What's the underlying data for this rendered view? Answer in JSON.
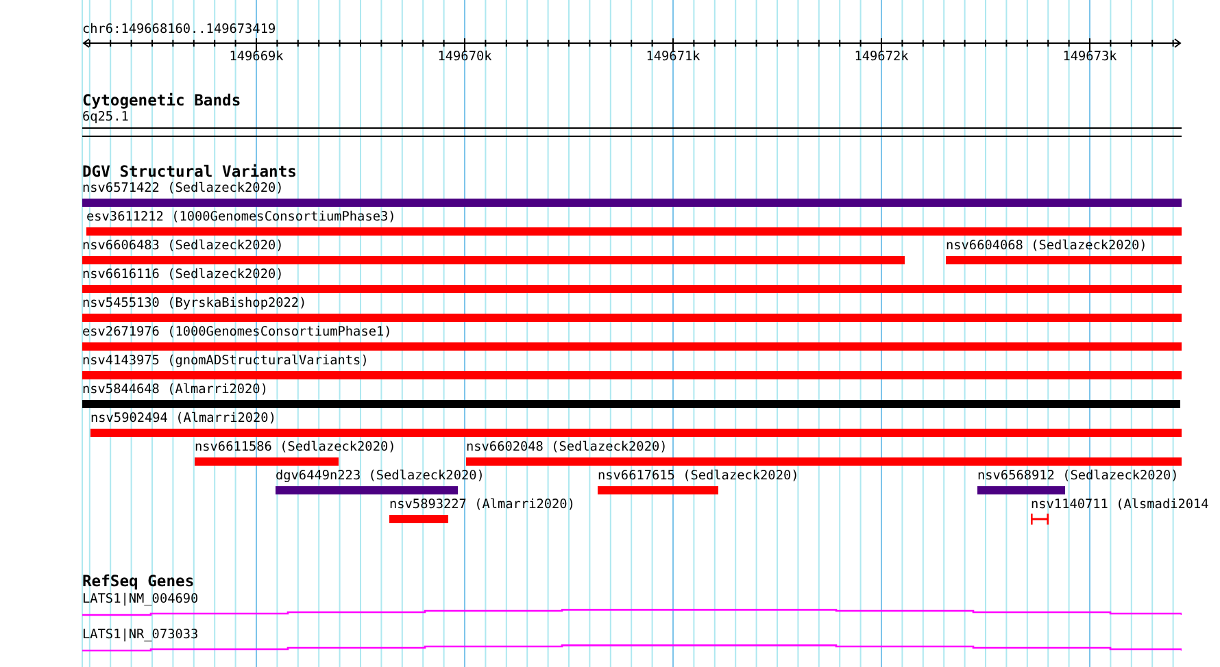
{
  "region": "chr6:149668160..149673419",
  "ruler": {
    "ticks": [
      "149669k",
      "149670k",
      "149671k",
      "149672k",
      "149673k"
    ]
  },
  "cytogenetic_bands": {
    "title": "Cytogenetic Bands",
    "band": "6q25.1"
  },
  "dgv": {
    "title": "DGV Structural Variants",
    "rows": [
      {
        "features": [
          {
            "label": "nsv6571422 (Sedlazeck2020)",
            "color": "#4b0082",
            "kind": "bar"
          }
        ]
      },
      {
        "features": [
          {
            "label": "esv3611212 (1000GenomesConsortiumPhase3)",
            "color": "#ff0000",
            "kind": "bar"
          }
        ]
      },
      {
        "features": [
          {
            "label": "nsv6606483 (Sedlazeck2020)",
            "color": "#ff0000",
            "kind": "bar"
          },
          {
            "label": "nsv6604068 (Sedlazeck2020)",
            "color": "#ff0000",
            "kind": "bar"
          }
        ]
      },
      {
        "features": [
          {
            "label": "nsv6616116 (Sedlazeck2020)",
            "color": "#ff0000",
            "kind": "bar"
          }
        ]
      },
      {
        "features": [
          {
            "label": "nsv5455130 (ByrskaBishop2022)",
            "color": "#ff0000",
            "kind": "bar"
          }
        ]
      },
      {
        "features": [
          {
            "label": "esv2671976 (1000GenomesConsortiumPhase1)",
            "color": "#ff0000",
            "kind": "bar"
          }
        ]
      },
      {
        "features": [
          {
            "label": "nsv4143975 (gnomADStructuralVariants)",
            "color": "#ff0000",
            "kind": "bar"
          }
        ]
      },
      {
        "features": [
          {
            "label": "nsv5844648 (Almarri2020)",
            "color": "#000000",
            "kind": "bar"
          }
        ]
      },
      {
        "features": [
          {
            "label": "nsv5902494 (Almarri2020)",
            "color": "#ff0000",
            "kind": "bar"
          }
        ]
      },
      {
        "features": [
          {
            "label": "nsv6611586 (Sedlazeck2020)",
            "color": "#ff0000",
            "kind": "bar"
          },
          {
            "label": "nsv6602048 (Sedlazeck2020)",
            "color": "#ff0000",
            "kind": "bar"
          }
        ]
      },
      {
        "features": [
          {
            "label": "dgv6449n223 (Sedlazeck2020)",
            "color": "#4b0082",
            "kind": "bar"
          },
          {
            "label": "nsv6617615 (Sedlazeck2020)",
            "color": "#ff0000",
            "kind": "bar"
          },
          {
            "label": "nsv6568912 (Sedlazeck2020)",
            "color": "#4b0082",
            "kind": "bar"
          }
        ]
      },
      {
        "features": [
          {
            "label": "nsv5893227 (Almarri2020)",
            "color": "#ff0000",
            "kind": "bar"
          },
          {
            "label": "nsv1140711 (Alsmadi2014",
            "color": "#ff0000",
            "kind": "interval"
          }
        ]
      }
    ]
  },
  "refseq": {
    "title": "RefSeq Genes",
    "genes": [
      {
        "label": "LATS1|NM_004690"
      },
      {
        "label": "LATS1|NR_073033"
      }
    ]
  }
}
